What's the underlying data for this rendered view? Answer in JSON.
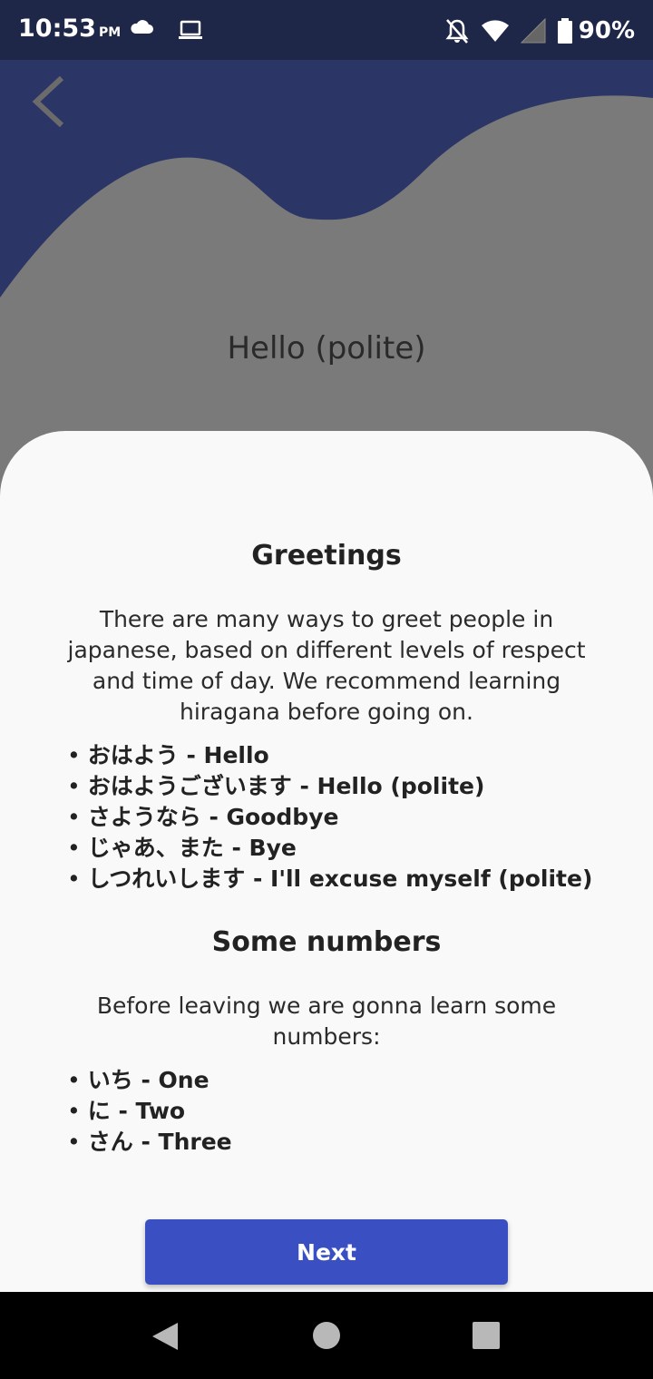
{
  "status_bar": {
    "time": "10:53",
    "ampm": "PM",
    "battery": "90%",
    "icons": [
      "cloud-icon",
      "laptop-icon",
      "notifications-off-icon",
      "wifi-icon",
      "signal-icon",
      "battery-icon"
    ]
  },
  "header": {
    "back_icon": "chevron-left-icon",
    "phrase": "Hello (polite)"
  },
  "colors": {
    "status_bar": "#1f2748",
    "header_wave": "#2b3566",
    "header_background": "#7a7a7a",
    "card": "#f9f9f9",
    "button": "#3a50c2"
  },
  "content": {
    "greetings": {
      "title": "Greetings",
      "lines": [
        "There are many ways to greet people in",
        "japanese, based on different levels of respect",
        "and time of day. We recommend learning",
        "hiragana before going on."
      ],
      "items": [
        "おはよう - Hello",
        "おはようございます - Hello (polite)",
        "さようなら - Goodbye",
        "じゃあ、また - Bye",
        "しつれいします - I'll excuse myself (polite)"
      ]
    },
    "numbers": {
      "title": "Some numbers",
      "lines": [
        "Before leaving we are gonna learn some",
        "numbers:"
      ],
      "items": [
        "いち - One",
        "に - Two",
        "さん - Three"
      ]
    },
    "bullet": "•"
  },
  "next_button": {
    "label": "Next"
  },
  "nav_bar": {
    "icons": [
      "back-triangle-icon",
      "home-circle-icon",
      "recents-square-icon"
    ]
  }
}
